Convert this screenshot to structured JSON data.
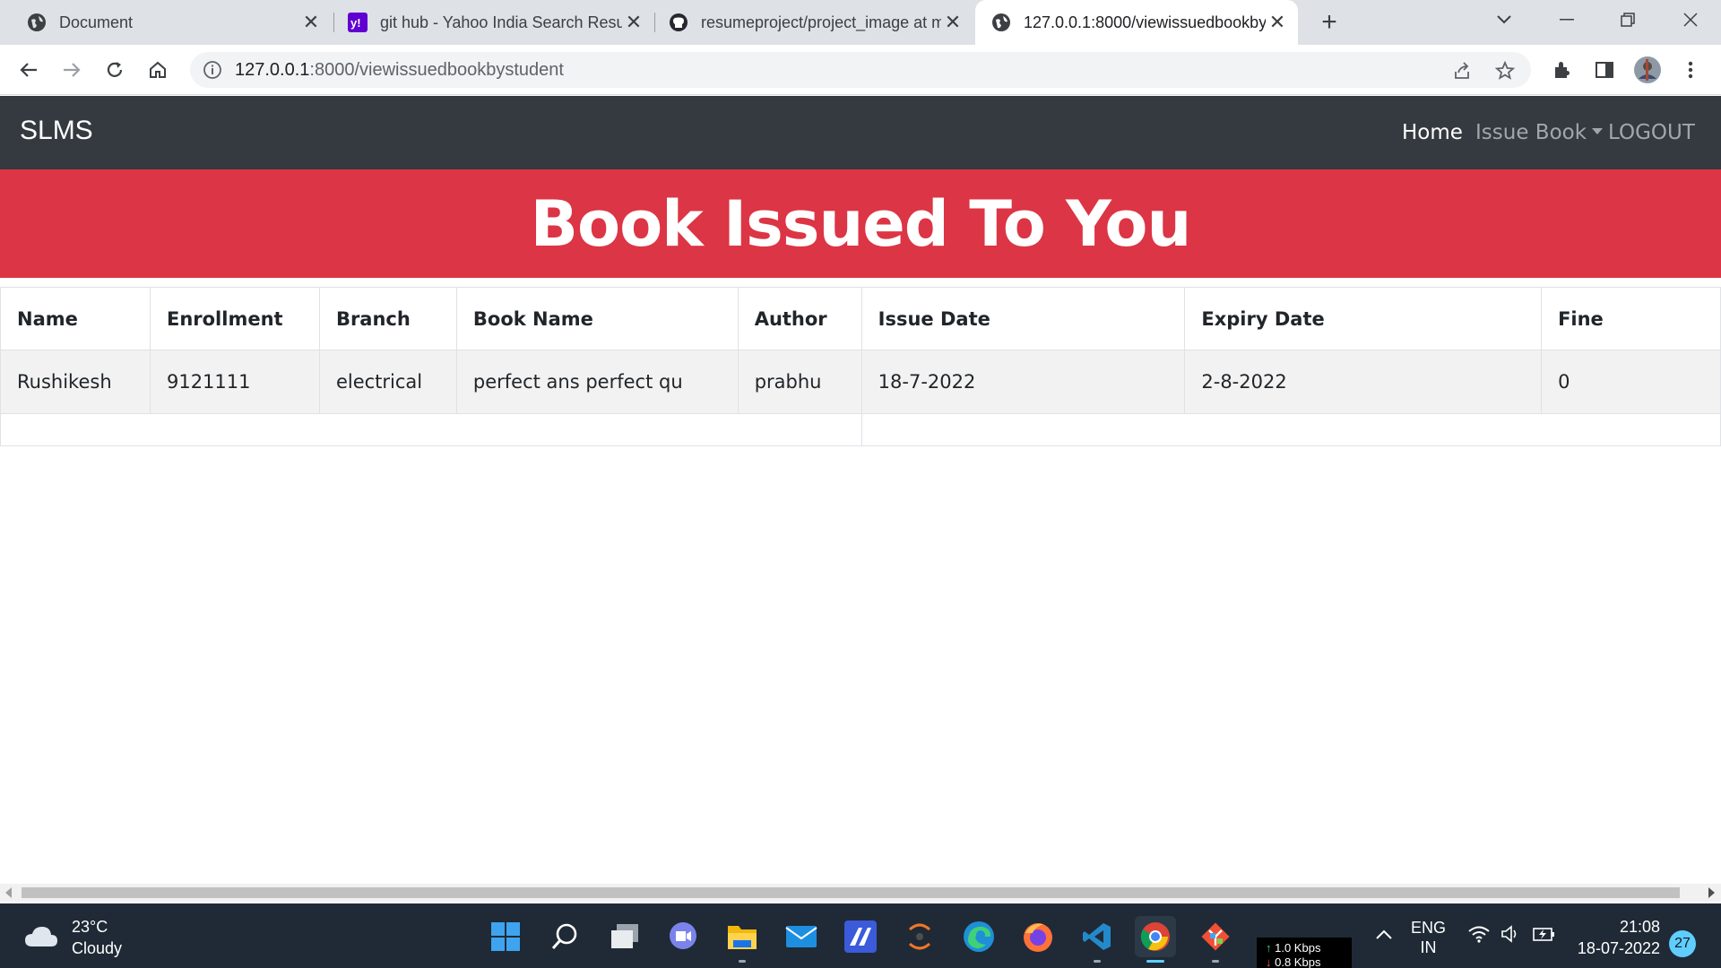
{
  "browser": {
    "tabs": [
      {
        "title": "Document",
        "favicon": "globe-icon",
        "active": false
      },
      {
        "title": "git hub - Yahoo India Search Resu",
        "favicon": "yahoo-icon",
        "active": false
      },
      {
        "title": "resumeproject/project_image at m",
        "favicon": "github-icon",
        "active": false
      },
      {
        "title": "127.0.0.1:8000/viewissuedbookbys",
        "favicon": "globe-icon",
        "active": true
      }
    ],
    "url_host": "127.0.0.1",
    "url_rest": ":8000/viewissuedbookbystudent"
  },
  "navbar": {
    "brand": "SLMS",
    "links": {
      "home": "Home",
      "issue_book": "Issue Book",
      "logout": "LOGOUT"
    }
  },
  "page": {
    "heading": "Book Issued To You"
  },
  "table": {
    "headers": [
      "Name",
      "Enrollment",
      "Branch",
      "Book Name",
      "Author",
      "Issue Date",
      "Expiry Date",
      "Fine"
    ],
    "rows": [
      [
        "Rushikesh",
        "9121111",
        "electrical",
        "perfect ans perfect qu",
        "prabhu",
        "18-7-2022",
        "2-8-2022",
        "0"
      ]
    ]
  },
  "taskbar": {
    "weather_temp": "23°C",
    "weather_desc": "Cloudy",
    "net_up": "1.0 Kbps",
    "net_down": "0.8 Kbps",
    "lang": "ENG",
    "region": "IN",
    "time": "21:08",
    "date": "18-07-2022",
    "notification_count": "27",
    "apps": [
      "windows-start-icon",
      "search-icon",
      "task-view-icon",
      "teams-chat-icon",
      "file-explorer-icon",
      "mail-icon",
      "app-icon",
      "eclipse-icon",
      "edge-icon",
      "firefox-icon",
      "vscode-icon",
      "chrome-icon",
      "git-icon"
    ]
  },
  "colors": {
    "navbar_bg": "#343a40",
    "hero_bg": "#dc3545",
    "taskbar_bg": "#1f2a36"
  }
}
